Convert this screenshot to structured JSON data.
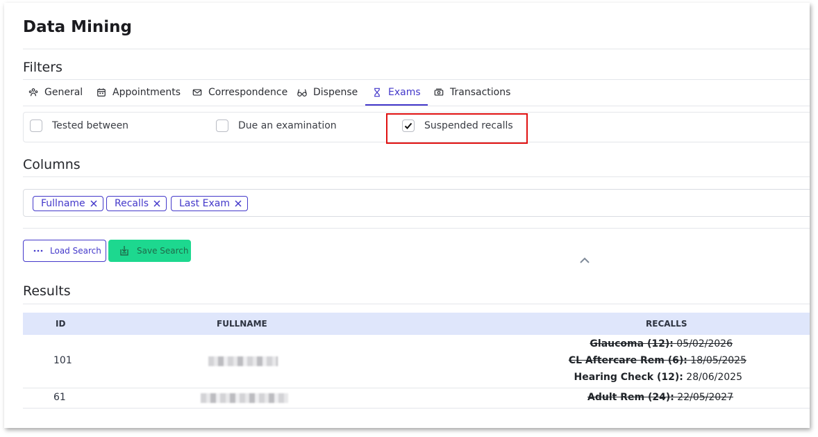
{
  "page": {
    "title": "Data Mining"
  },
  "filters": {
    "heading": "Filters",
    "tabs": [
      {
        "label": "General",
        "icon": "people-icon"
      },
      {
        "label": "Appointments",
        "icon": "calendar-icon"
      },
      {
        "label": "Correspondence",
        "icon": "envelope-icon"
      },
      {
        "label": "Dispense",
        "icon": "glasses-icon"
      },
      {
        "label": "Exams",
        "icon": "hourglass-icon",
        "active": true
      },
      {
        "label": "Transactions",
        "icon": "cash-icon"
      }
    ],
    "options": [
      {
        "label": "Tested between",
        "checked": false
      },
      {
        "label": "Due an examination",
        "checked": false
      },
      {
        "label": "Suspended recalls",
        "checked": true
      }
    ]
  },
  "columns": {
    "heading": "Columns",
    "chips": [
      "Fullname",
      "Recalls",
      "Last Exam"
    ]
  },
  "actions": {
    "load_search": "Load Search",
    "save_search": "Save Search"
  },
  "results": {
    "heading": "Results",
    "headers": {
      "id": "ID",
      "fullname": "FULLNAME",
      "recalls": "RECALLS"
    },
    "rows": [
      {
        "id": "101",
        "recalls": [
          {
            "name": "Glaucoma (12):",
            "date": "05/02/2026",
            "suspended": true
          },
          {
            "name": "CL Aftercare Rem (6):",
            "date": "18/05/2025",
            "suspended": true
          },
          {
            "name": "Hearing Check (12):",
            "date": "28/06/2025",
            "suspended": false
          }
        ]
      },
      {
        "id": "61",
        "recalls": [
          {
            "name": "Adult Rem (24):",
            "date": "22/05/2027",
            "suspended": true
          }
        ]
      }
    ]
  },
  "colors": {
    "accent": "#4338ca",
    "save_button": "#1dd88f",
    "table_header": "#dfe6fb",
    "highlight": "#e01010"
  }
}
